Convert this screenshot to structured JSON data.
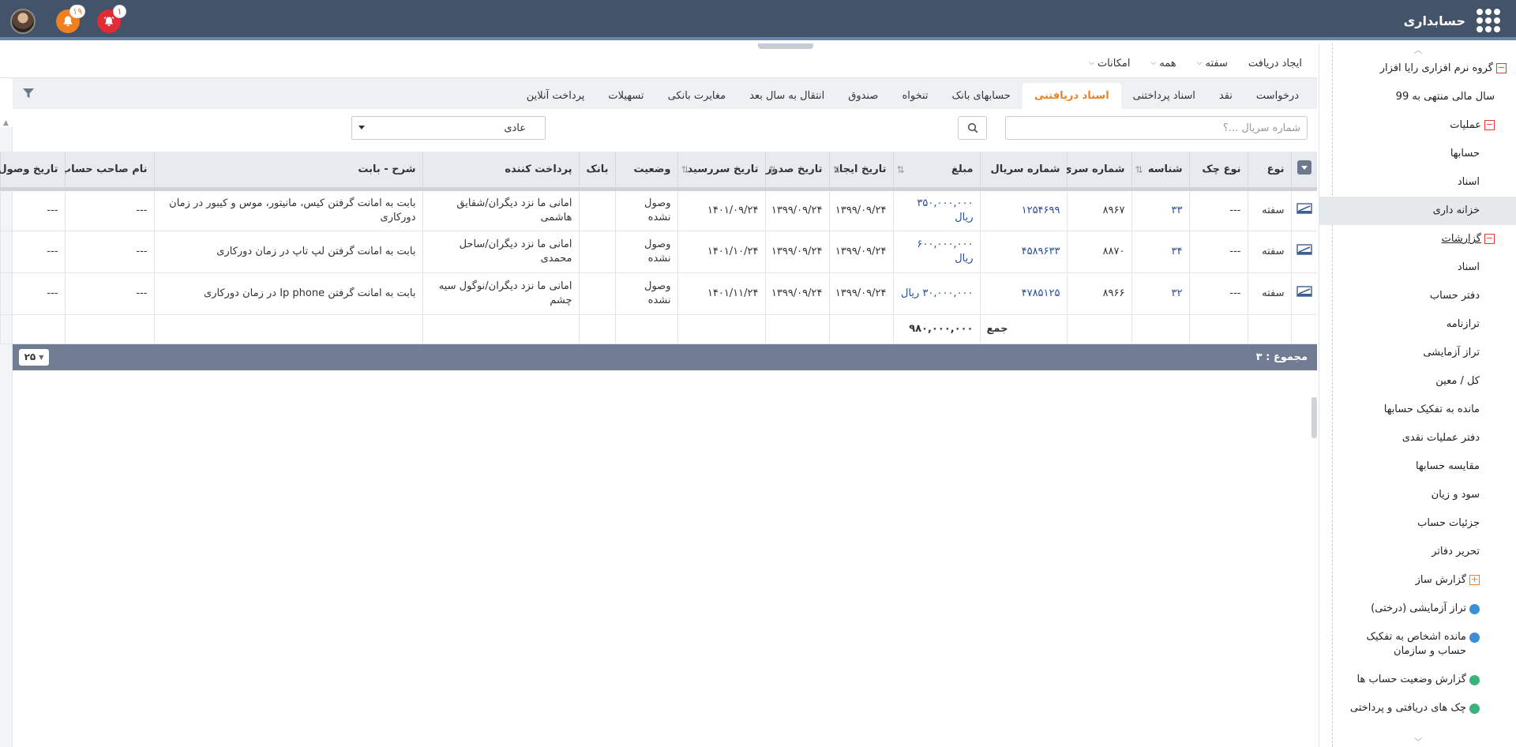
{
  "app": {
    "title": "حسابداری",
    "notifications": [
      {
        "count": "۱",
        "color": "#e12b36"
      },
      {
        "count": "۱۹",
        "color": "#f07f20"
      }
    ]
  },
  "sidebar": {
    "items": [
      {
        "label": "گروه نرم افزاری رایا افزار",
        "level": 1,
        "expander": "minus"
      },
      {
        "label": "سال مالی منتهی به 99",
        "level": 2
      },
      {
        "label": "عملیات",
        "level": 2,
        "expander": "minus"
      },
      {
        "label": "حسابها",
        "level": 3
      },
      {
        "label": "اسناد",
        "level": 3
      },
      {
        "label": "خزانه داری",
        "level": 3,
        "active": true
      },
      {
        "label": "گزارشات",
        "level": 2,
        "expander": "minus"
      },
      {
        "label": "اسناد",
        "level": 3
      },
      {
        "label": "دفتر حساب",
        "level": 3
      },
      {
        "label": "ترازنامه",
        "level": 3
      },
      {
        "label": "تراز آزمایشی",
        "level": 3
      },
      {
        "label": "کل / معین",
        "level": 3
      },
      {
        "label": "مانده به تفکیک حسابها",
        "level": 3
      },
      {
        "label": "دفتر عملیات نقدی",
        "level": 3
      },
      {
        "label": "مقایسه حسابها",
        "level": 3
      },
      {
        "label": "سود و زیان",
        "level": 3
      },
      {
        "label": "جزئیات حساب",
        "level": 3
      },
      {
        "label": "تحریر دفاتر",
        "level": 3
      },
      {
        "label": "گزارش ساز",
        "level": 3,
        "expander": "plus"
      },
      {
        "label": "تراز آزمایشی (درختی)",
        "level": 3,
        "icon": "report-blue"
      },
      {
        "label": "مانده اشخاص به تفکیک حساب و سازمان",
        "level": 3,
        "icon": "report-blue"
      },
      {
        "label": "گزارش وضعیت حساب ها",
        "level": 3,
        "icon": "report-green"
      },
      {
        "label": "چک های دریافتی و پرداختی",
        "level": 3,
        "icon": "report-green"
      }
    ]
  },
  "toolbar": {
    "items": [
      {
        "label": "ایجاد دریافت",
        "dropdown": false
      },
      {
        "label": "سفته",
        "dropdown": true
      },
      {
        "label": "همه",
        "dropdown": true
      },
      {
        "label": "امکانات",
        "dropdown": true
      }
    ]
  },
  "tabs": [
    {
      "label": "درخواست"
    },
    {
      "label": "نقد"
    },
    {
      "label": "اسناد پرداختنی"
    },
    {
      "label": "اسناد دریافتنی",
      "active": true
    },
    {
      "label": "حسابهای بانک"
    },
    {
      "label": "تنخواه"
    },
    {
      "label": "صندوق"
    },
    {
      "label": "انتقال به سال بعد"
    },
    {
      "label": "مغایرت بانکی"
    },
    {
      "label": "تسهیلات"
    },
    {
      "label": "پرداخت آنلاین"
    }
  ],
  "search": {
    "placeholder": "شماره سریال ...؟",
    "type_value": "عادی"
  },
  "table": {
    "columns": [
      "نوع",
      "نوع چک",
      "شناسه",
      "شماره سری",
      "شماره سریال",
      "مبلغ",
      "تاریخ ایجاد",
      "تاریخ صدور",
      "تاریخ سررسید",
      "وضعیت",
      "بانک",
      "پرداخت کننده",
      "شرح - بابت",
      "نام صاحب حساب",
      "تاریخ وصول"
    ],
    "rows": [
      {
        "type": "سفته",
        "check_type": "---",
        "id": "۳۳",
        "series": "۸۹۶۷",
        "serial": "۱۲۵۴۶۹۹",
        "amount": "۳۵۰,۰۰۰,۰۰۰ ریال",
        "created": "۱۳۹۹/۰۹/۲۴",
        "issued": "۱۳۹۹/۰۹/۲۴",
        "due": "۱۴۰۱/۰۹/۲۴",
        "status": "وصول نشده",
        "bank": "",
        "payer": "امانی ما نزد دیگران/شقایق هاشمی",
        "description": "بابت به امانت گرفتن کیس، مانیتور، موس و کیبور در زمان دورکاری",
        "owner": "---",
        "received": "---"
      },
      {
        "type": "سفته",
        "check_type": "---",
        "id": "۳۴",
        "series": "۸۸۷۰",
        "serial": "۴۵۸۹۶۳۳",
        "amount": "۶۰۰,۰۰۰,۰۰۰ ریال",
        "created": "۱۳۹۹/۰۹/۲۴",
        "issued": "۱۳۹۹/۰۹/۲۴",
        "due": "۱۴۰۱/۱۰/۲۴",
        "status": "وصول نشده",
        "bank": "",
        "payer": "امانی ما نزد دیگران/ساحل محمدی",
        "description": "بابت به امانت گرفتن لپ تاپ در زمان دورکاری",
        "owner": "---",
        "received": "---"
      },
      {
        "type": "سفته",
        "check_type": "---",
        "id": "۳۲",
        "series": "۸۹۶۶",
        "serial": "۴۷۸۵۱۲۵",
        "amount": "۳۰,۰۰۰,۰۰۰ ریال",
        "created": "۱۳۹۹/۰۹/۲۴",
        "issued": "۱۳۹۹/۰۹/۲۴",
        "due": "۱۴۰۱/۱۱/۲۴",
        "status": "وصول نشده",
        "bank": "",
        "payer": "امانی ما نزد دیگران/نوگول سیه چشم",
        "description": "بابت به امانت گرفتن Ip phone در زمان دورکاری",
        "owner": "---",
        "received": "---"
      }
    ],
    "sum_label": "جمع",
    "sum_value": "۹۸۰,۰۰۰,۰۰۰"
  },
  "footer": {
    "total_label": "مجموع : ۳",
    "page_size": "۲۵"
  },
  "colors": {
    "topbar": "#435369",
    "accent": "#f07f20",
    "link": "#2a4d9c",
    "footer": "#6f7c91"
  }
}
